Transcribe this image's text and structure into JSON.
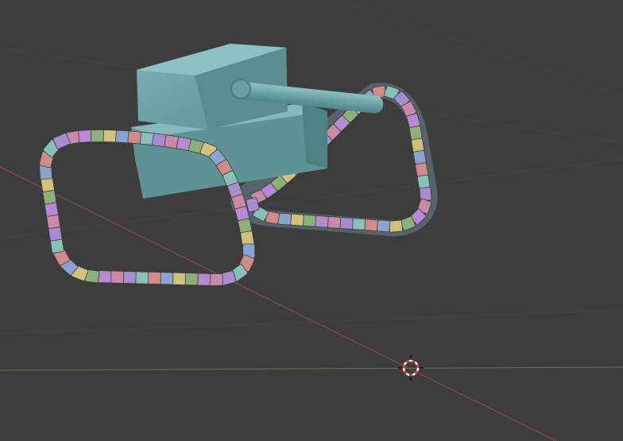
{
  "viewport": {
    "background": "#3d3d3d",
    "grid_color": "#464646",
    "x_axis_color": "#9c4a52",
    "y_axis_color": "#6b7a3a"
  },
  "model": {
    "body_color": "#6fa1a3",
    "body_shade": "#4f8385",
    "track_segment_colors": [
      "#c98aa8",
      "#b68ad0",
      "#8bb07a",
      "#cfc27c",
      "#8ba4cf",
      "#d08a8a",
      "#86c0b8",
      "#a98bd0"
    ]
  },
  "cursor": {
    "icon": "3d-cursor-icon",
    "ring_color_a": "#e23b3b",
    "ring_color_b": "#ffffff"
  }
}
